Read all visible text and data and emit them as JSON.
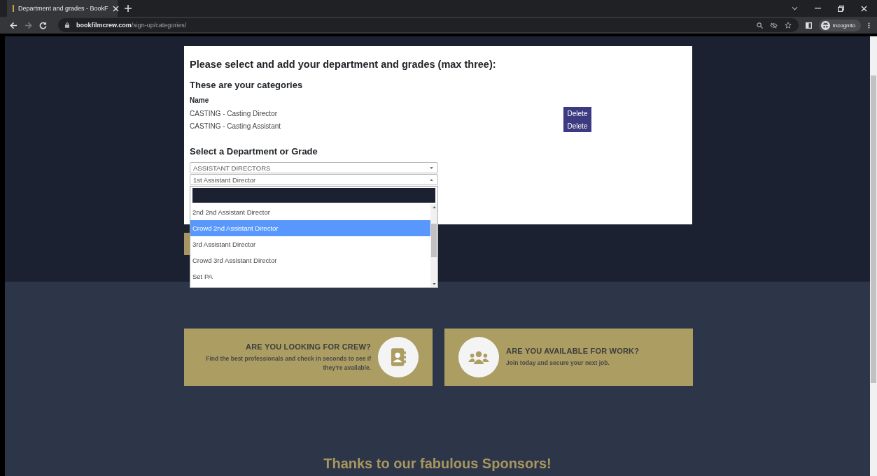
{
  "browser": {
    "tab_title": "Department and grades - BookF",
    "url_domain": "bookfilmcrew.com",
    "url_path": "/sign-up/categories/",
    "profile": "Incognito"
  },
  "form": {
    "heading": "Please select and add your department and grades (max three):",
    "subheading": "These are your categories",
    "column": "Name",
    "categories": [
      {
        "name": "CASTING - Casting Director",
        "action": "Delete"
      },
      {
        "name": "CASTING - Casting Assistant",
        "action": "Delete"
      }
    ],
    "select_heading": "Select a Department or Grade",
    "department": "ASSISTANT DIRECTORS",
    "grade": "1st Assistant Director",
    "options": [
      {
        "label": "2nd 2nd Assistant Director",
        "selected": false
      },
      {
        "label": "Crowd 2nd Assistant Director",
        "selected": true
      },
      {
        "label": "3rd Assistant Director",
        "selected": false
      },
      {
        "label": "Crowd 3rd Assistant Director",
        "selected": false
      },
      {
        "label": "Set PA",
        "selected": false
      }
    ]
  },
  "promos": [
    {
      "kind": "crew",
      "title": "ARE YOU LOOKING FOR CREW?",
      "text": "Find the best professionals and check in seconds to see if they’re available."
    },
    {
      "kind": "work",
      "title": "ARE YOU AVAILABLE FOR WORK?",
      "text": "Join today and secure your next job."
    }
  ],
  "sponsors_heading": "Thanks to our fabulous Sponsors!"
}
